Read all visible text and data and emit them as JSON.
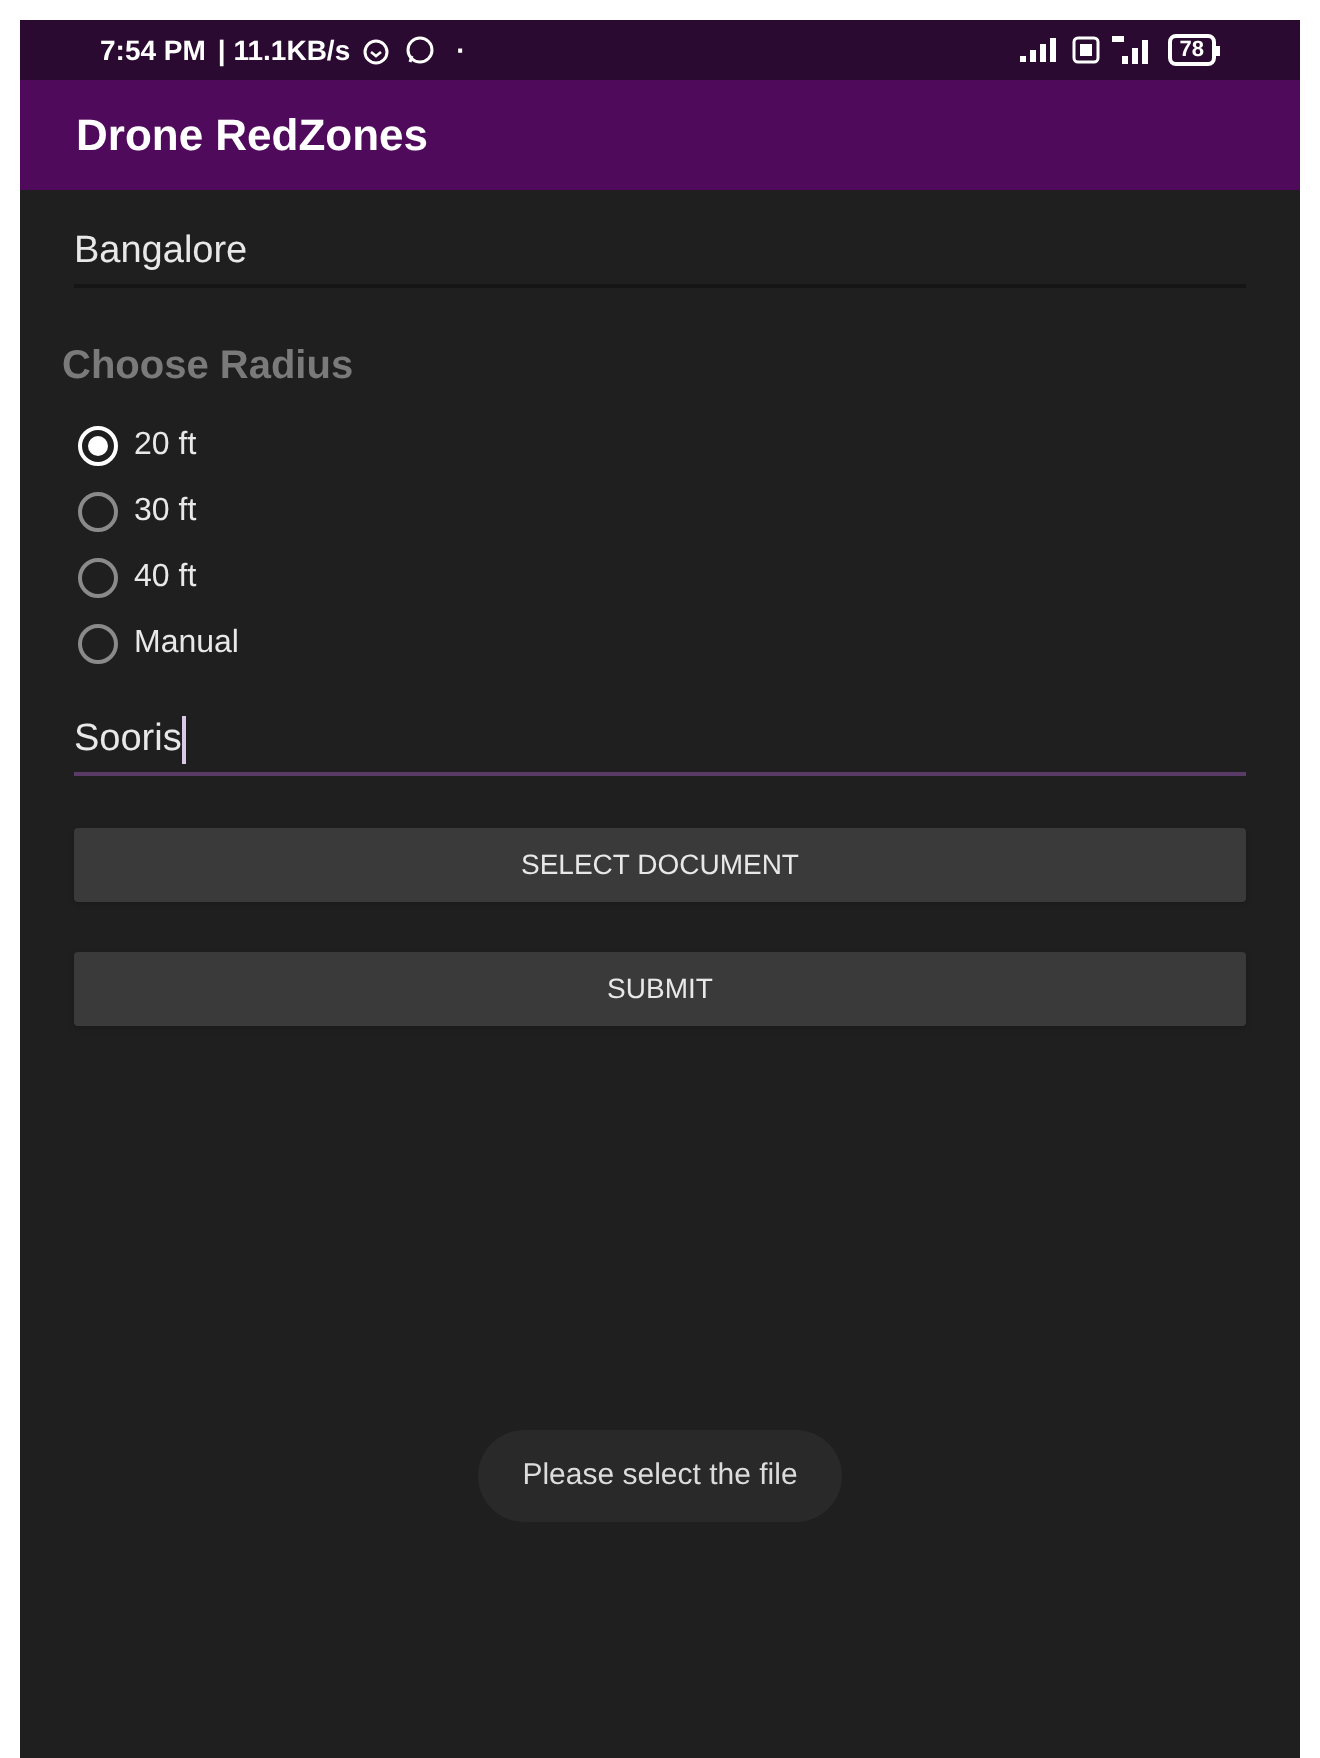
{
  "status_bar": {
    "time": "7:54 PM",
    "separator": "|",
    "speed": "11.1KB/s",
    "dot": "·",
    "battery": "78"
  },
  "app_bar": {
    "title": "Drone RedZones"
  },
  "location_field": {
    "value": "Bangalore",
    "focused": false
  },
  "radius": {
    "heading": "Choose Radius",
    "options": [
      {
        "label": "20 ft",
        "selected": true
      },
      {
        "label": "30 ft",
        "selected": false
      },
      {
        "label": "40 ft",
        "selected": false
      },
      {
        "label": "Manual",
        "selected": false
      }
    ]
  },
  "name_field": {
    "value": "Sooris",
    "focused": true
  },
  "buttons": [
    "SELECT DOCUMENT",
    "SUBMIT"
  ],
  "toast": "Please select the file"
}
